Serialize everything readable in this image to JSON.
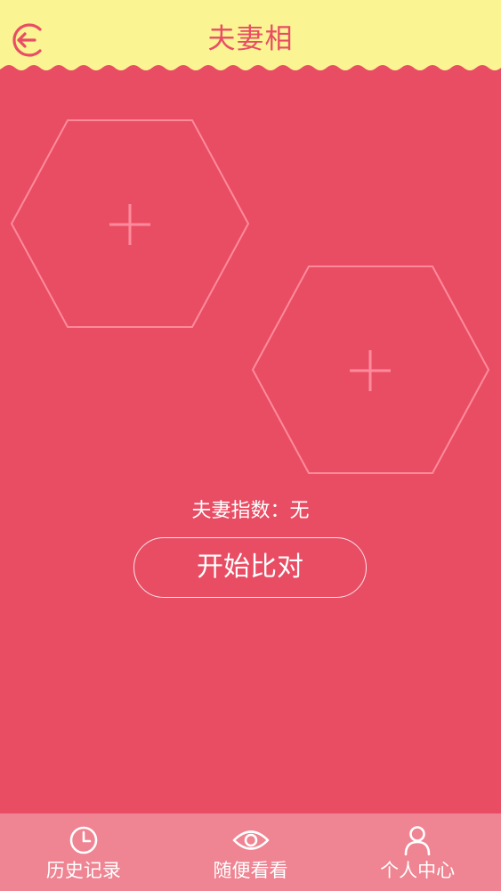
{
  "header": {
    "title": "夫妻相",
    "back_icon": "back-arrow-icon",
    "background_color": "#fbf493",
    "accent_color": "#e84d64"
  },
  "slots": [
    {
      "icon": "plus-icon"
    },
    {
      "icon": "plus-icon"
    }
  ],
  "result": {
    "index_text": "夫妻指数：无"
  },
  "actions": {
    "start_label": "开始比对"
  },
  "bottom_nav": {
    "background_color": "#ef8492",
    "items": [
      {
        "label": "历史记录",
        "icon": "clock-icon"
      },
      {
        "label": "随便看看",
        "icon": "eye-icon"
      },
      {
        "label": "个人中心",
        "icon": "user-icon"
      }
    ]
  },
  "theme": {
    "page_background": "#e84d64",
    "hexagon_stroke": "#ff8a9c"
  }
}
